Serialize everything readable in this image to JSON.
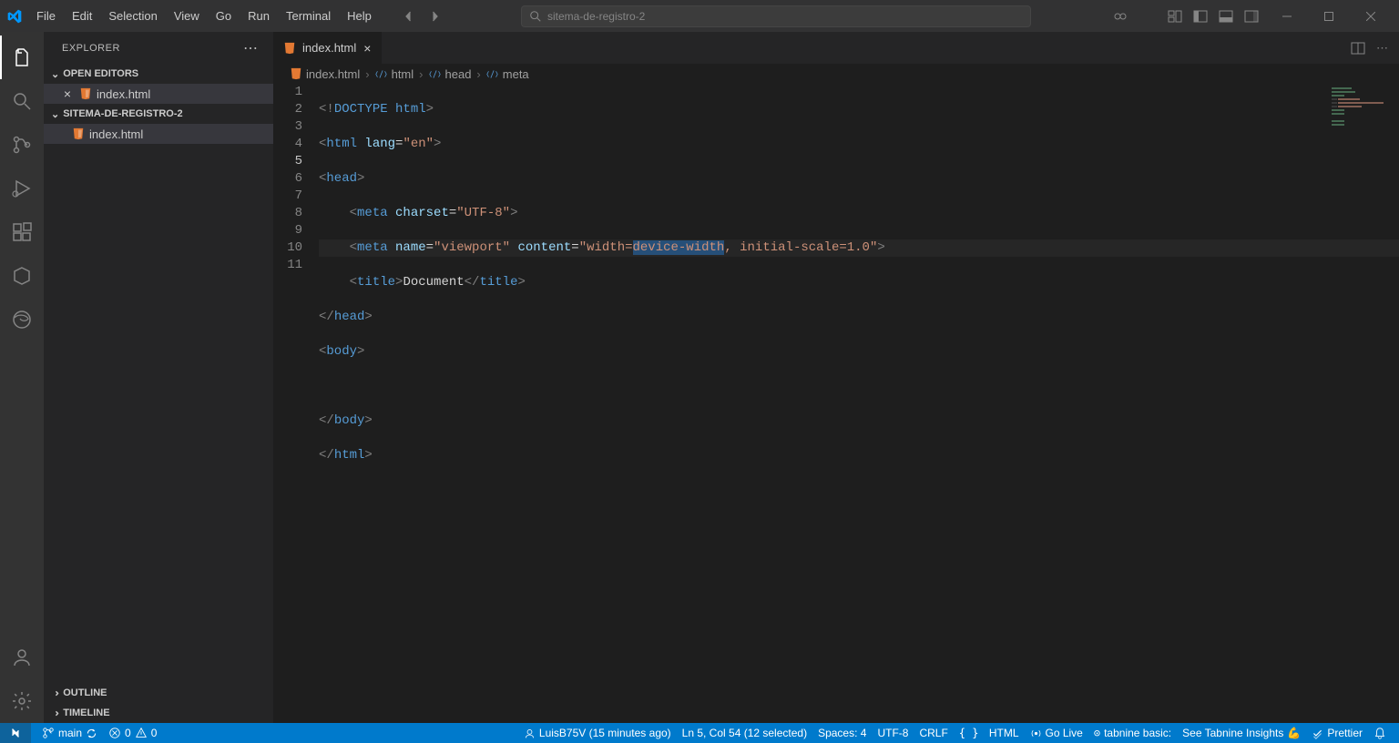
{
  "menu": [
    "File",
    "Edit",
    "Selection",
    "View",
    "Go",
    "Run",
    "Terminal",
    "Help"
  ],
  "searchPlaceholder": "sitema-de-registro-2",
  "explorer": {
    "title": "EXPLORER",
    "openEditors": "OPEN EDITORS",
    "workspace": "SITEMA-DE-REGISTRO-2",
    "fileName": "index.html",
    "outline": "OUTLINE",
    "timeline": "TIMELINE"
  },
  "tab": {
    "name": "index.html"
  },
  "breadcrumb": {
    "file": "index.html",
    "path": [
      "html",
      "head",
      "meta"
    ]
  },
  "code": {
    "lineNumbers": [
      "1",
      "2",
      "3",
      "4",
      "5",
      "6",
      "7",
      "8",
      "9",
      "10",
      "11"
    ],
    "activeLine": 5
  },
  "status": {
    "branch": "main",
    "errors": "0",
    "warnings": "0",
    "blame": "LuisB75V (15 minutes ago)",
    "cursor": "Ln 5, Col 54 (12 selected)",
    "spaces": "Spaces: 4",
    "encoding": "UTF-8",
    "eol": "CRLF",
    "lang": "HTML",
    "goLive": "Go Live",
    "tabnine": "tabnine basic:",
    "tabnineInsights": "See Tabnine Insights",
    "prettier": "Prettier"
  },
  "codeText": {
    "doctype": "DOCTYPE",
    "htmlWord": "html",
    "lang": "lang",
    "en": "\"en\"",
    "head": "head",
    "meta": "meta",
    "charset": "charset",
    "utf8": "\"UTF-8\"",
    "name": "name",
    "viewport": "\"viewport\"",
    "content": "content",
    "widthPre": "\"width=",
    "deviceWidth": "device-width",
    "widthPost": ", initial-scale=1.0\"",
    "title": "title",
    "document": "Document",
    "body": "body"
  }
}
